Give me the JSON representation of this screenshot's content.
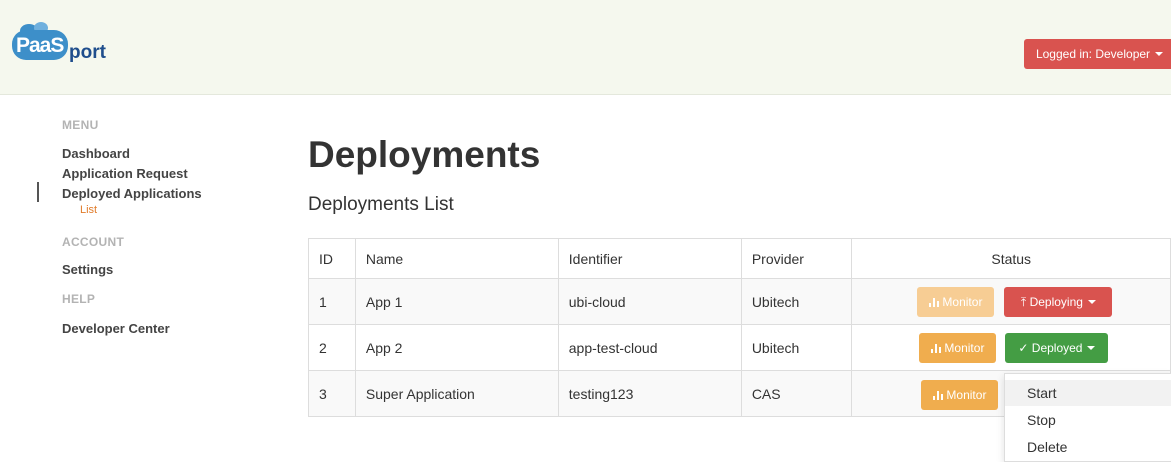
{
  "brand": {
    "part1": "PaaS",
    "part2": "port"
  },
  "header": {
    "login_label": "Logged in: Developer"
  },
  "sidebar": {
    "menu_heading": "MENU",
    "menu_items": [
      "Dashboard",
      "Application Request",
      "Deployed Applications"
    ],
    "submenu_item": "List",
    "account_heading": "ACCOUNT",
    "settings": "Settings",
    "help_heading": "HELP",
    "developer_center": "Developer Center"
  },
  "main": {
    "title": "Deployments",
    "subtitle": "Deployments List"
  },
  "table": {
    "headers": [
      "ID",
      "Name",
      "Identifier",
      "Provider",
      "Status"
    ],
    "rows": [
      {
        "id": "1",
        "name": "App 1",
        "identifier": "ubi-cloud",
        "provider": "Ubitech",
        "monitor": "Monitor",
        "status": "Deploying",
        "status_color": "#d9534f",
        "status_icon": "upload-icon",
        "monitor_disabled": true
      },
      {
        "id": "2",
        "name": "App 2",
        "identifier": "app-test-cloud",
        "provider": "Ubitech",
        "monitor": "Monitor",
        "status": "Deployed",
        "status_color": "#449d44",
        "status_icon": "check-icon",
        "monitor_disabled": false
      },
      {
        "id": "3",
        "name": "Super Application",
        "identifier": "testing123",
        "provider": "CAS",
        "monitor": "Monitor"
      }
    ]
  },
  "dropdown": {
    "items": [
      "Start",
      "Stop",
      "Delete"
    ],
    "highlighted": "Start"
  },
  "colors": {
    "danger": "#d9534f",
    "warning": "#f0ad4e",
    "success": "#449d44",
    "accent": "#e07b2a"
  }
}
